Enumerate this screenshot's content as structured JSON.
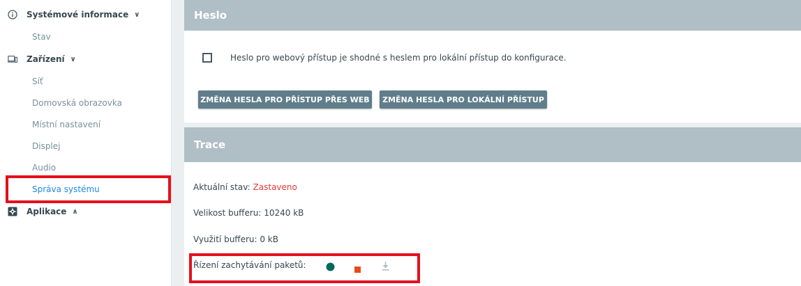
{
  "sidebar": {
    "groups": [
      {
        "label": "Systémové informace",
        "icon": "info-icon",
        "expanded": true,
        "items": [
          {
            "label": "Stav"
          }
        ]
      },
      {
        "label": "Zařízení",
        "icon": "device-icon",
        "expanded": true,
        "items": [
          {
            "label": "Síť"
          },
          {
            "label": "Domovská obrazovka"
          },
          {
            "label": "Místní nastavení"
          },
          {
            "label": "Displej"
          },
          {
            "label": "Audio"
          },
          {
            "label": "Správa systému",
            "active": true
          }
        ]
      },
      {
        "label": "Aplikace",
        "icon": "apps-icon",
        "expanded": false
      }
    ]
  },
  "password_panel": {
    "header": "Heslo",
    "checkbox_label": "Heslo pro webový přístup je shodné s heslem pro lokální přístup do konfigurace.",
    "checkbox_checked": false,
    "btn_web": "ZMĚNA HESLA PRO PŘÍSTUP PŘES WEB",
    "btn_local": "ZMĚNA HESLA PRO LOKÁLNÍ PŘÍSTUP"
  },
  "trace_panel": {
    "header": "Trace",
    "status_label": "Aktuální stav:",
    "status_value": "Zastaveno",
    "buffer_size": "Velikost bufferu: 10240 kB",
    "buffer_usage": "Využití bufferu: 0 kB",
    "capture_label": "Řízení zachytávání paketů:",
    "controls": [
      "record-icon",
      "stop-icon",
      "download-icon"
    ]
  },
  "colors": {
    "header_bg": "#b0bec5",
    "button_bg": "#607d8b",
    "active_link": "#1e88e5",
    "status_red": "#e53935",
    "record_green": "#00695c",
    "stop_orange": "#e64a19",
    "highlight_red": "#e5101c"
  }
}
